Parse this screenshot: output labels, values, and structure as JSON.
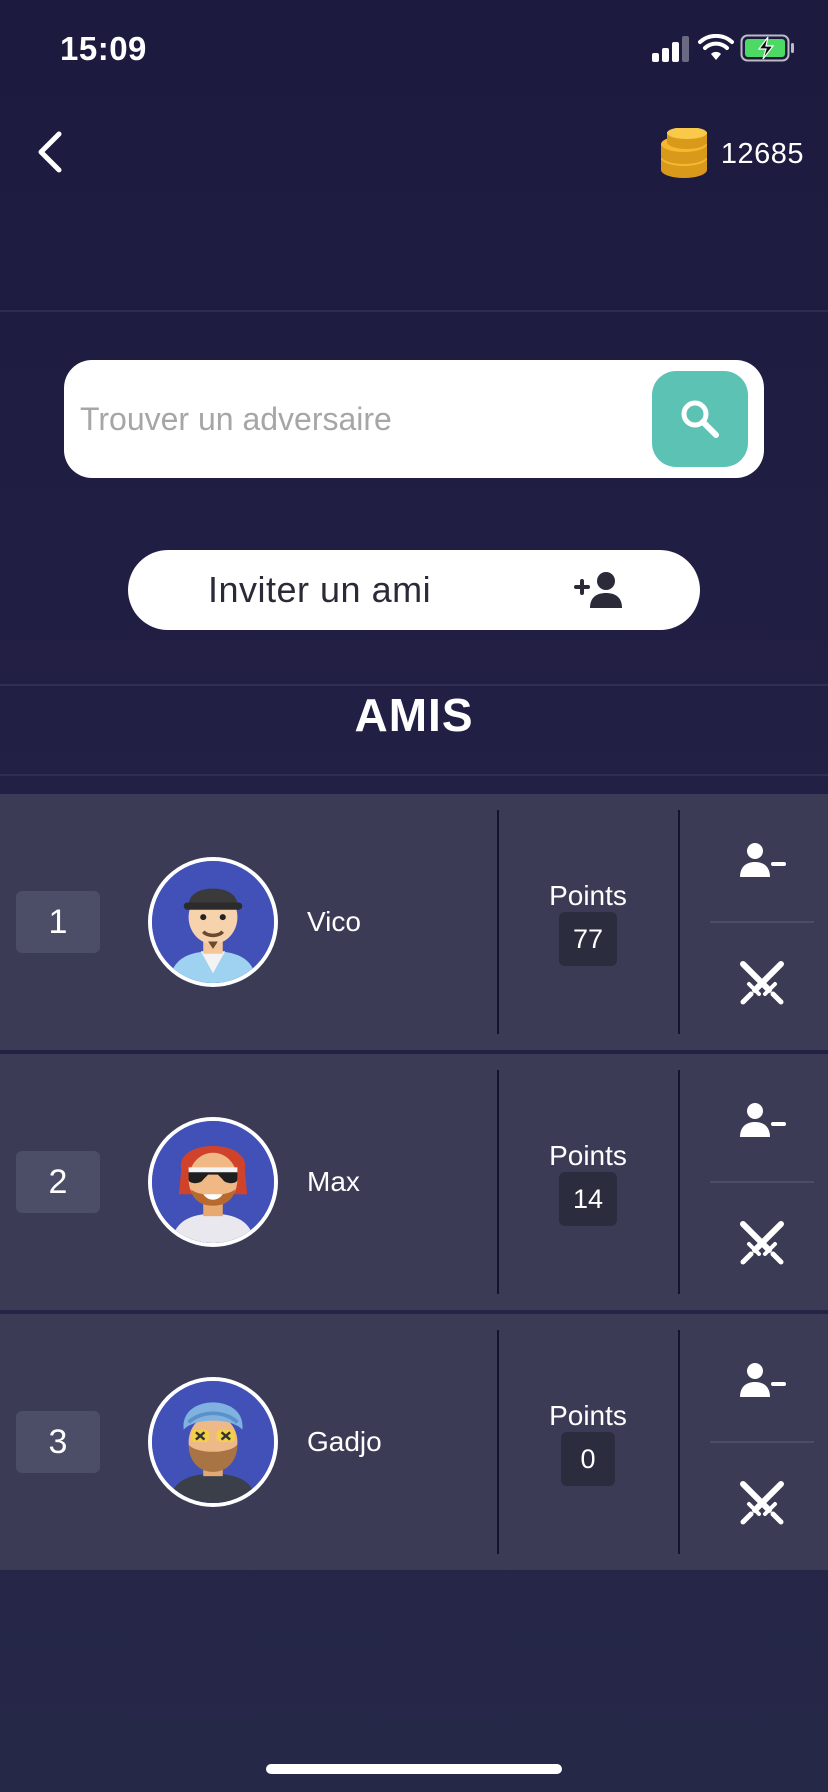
{
  "status_bar": {
    "time": "15:09"
  },
  "header": {
    "coins": "12685"
  },
  "search": {
    "placeholder": "Trouver un adversaire"
  },
  "invite": {
    "label": "Inviter un ami"
  },
  "section": {
    "title": "AMIS"
  },
  "friends": [
    {
      "rank": "1",
      "name": "Vico",
      "points_label": "Points",
      "points": "77"
    },
    {
      "rank": "2",
      "name": "Max",
      "points_label": "Points",
      "points": "14"
    },
    {
      "rank": "3",
      "name": "Gadjo",
      "points_label": "Points",
      "points": "0"
    }
  ],
  "colors": {
    "background": "#1c1a3e",
    "row": "#3b3b55",
    "accent_teal": "#5cc2b4",
    "coin_gold": "#f5b82e",
    "battery_green": "#4cd964"
  },
  "icons": {
    "back": "chevron-left-icon",
    "coins": "coin-stack-icon",
    "search": "search-icon",
    "invite": "add-user-icon",
    "remove": "remove-user-icon",
    "duel": "crossed-swords-icon"
  }
}
